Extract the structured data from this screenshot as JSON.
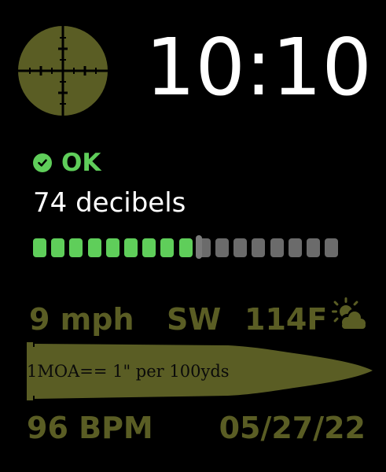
{
  "watch_face": {
    "time": "10:10",
    "noise": {
      "status": "OK",
      "decibel_text": "74 decibels",
      "meter": {
        "level_fraction": 0.455,
        "segments_total": 17,
        "segments_green": 9
      }
    },
    "weather": {
      "wind_speed": "9 mph",
      "wind_direction": "SW",
      "temperature": "114F",
      "condition_icon": "partly-cloudy-sun-icon"
    },
    "bullet_text": "1MOA== 1\" per 100yds",
    "heart_rate": "96 BPM",
    "date": "05/27/22"
  },
  "colors": {
    "background": "#000000",
    "olive": "#5a5d24",
    "olive_dark": "#0a0a0a",
    "ok_green": "#5fce5a",
    "meter_gray": "#6b6b6b",
    "text_white": "#ffffff"
  }
}
